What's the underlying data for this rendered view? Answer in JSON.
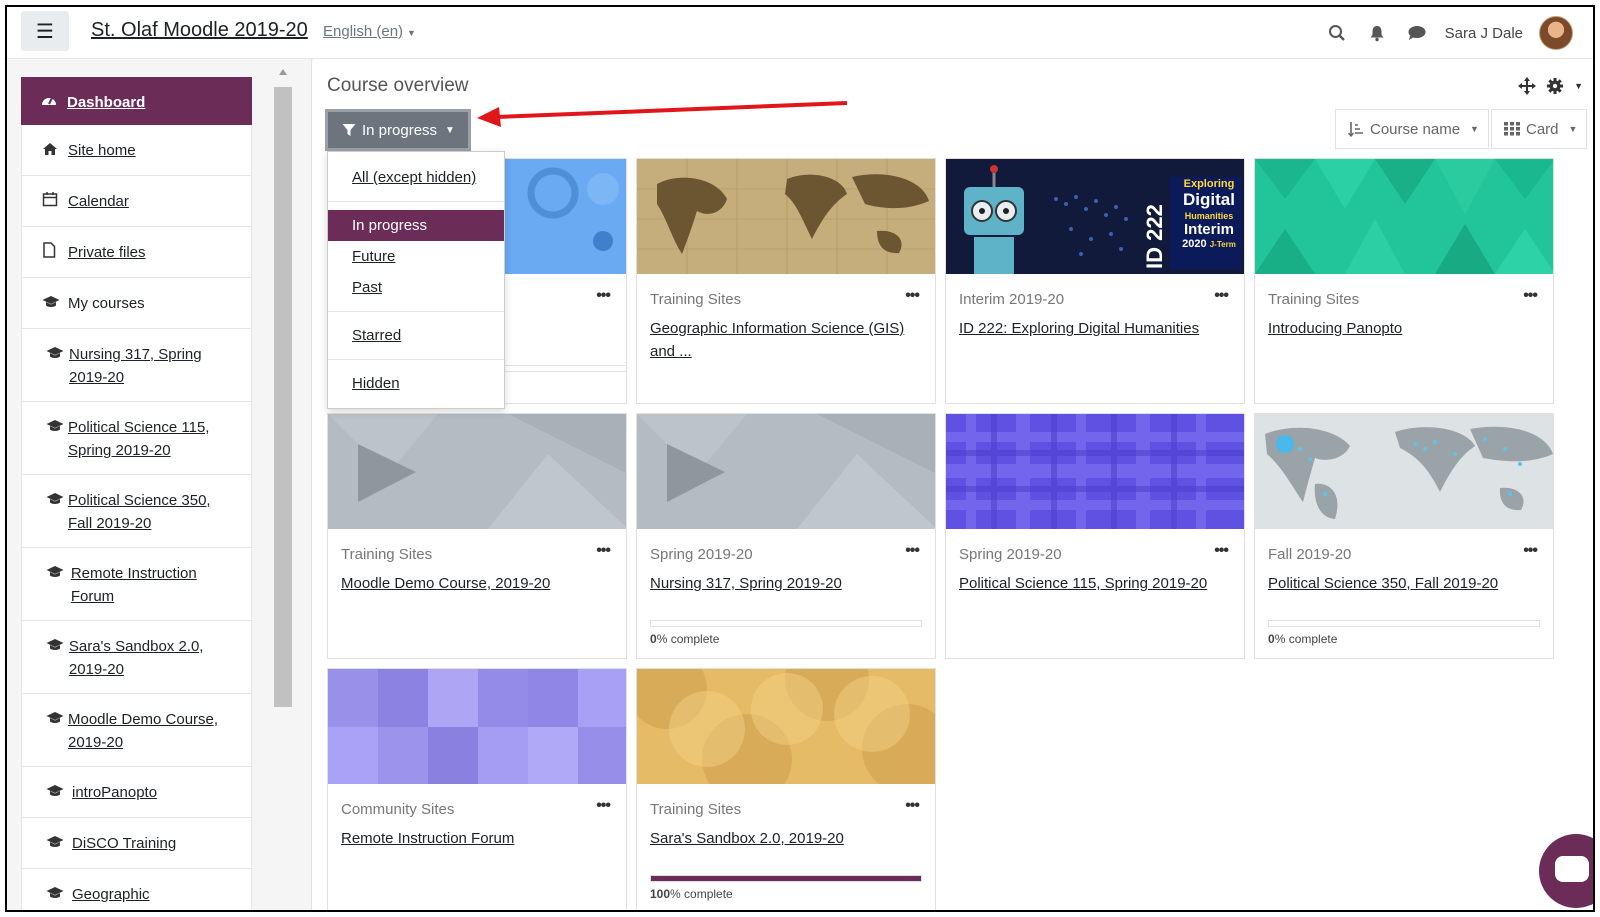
{
  "navbar": {
    "menu_icon": "hamburger-icon",
    "site_title": "St. Olaf Moodle 2019-20",
    "language": "English (en)",
    "user_name": "Sara J Dale"
  },
  "sidebar": {
    "items": [
      {
        "icon": "dashboard-icon",
        "label": "Dashboard"
      },
      {
        "icon": "home-icon",
        "label": "Site home"
      },
      {
        "icon": "calendar-icon",
        "label": "Calendar"
      },
      {
        "icon": "file-icon",
        "label": "Private files"
      },
      {
        "icon": "graduation-cap-icon",
        "label": "My courses"
      },
      {
        "icon": "graduation-cap-icon",
        "label": "Nursing 317, Spring 2019-20"
      },
      {
        "icon": "graduation-cap-icon",
        "label": "Political Science 115, Spring 2019-20"
      },
      {
        "icon": "graduation-cap-icon",
        "label": "Political Science 350, Fall 2019-20"
      },
      {
        "icon": "graduation-cap-icon",
        "label": "Remote Instruction Forum"
      },
      {
        "icon": "graduation-cap-icon",
        "label": "Sara's Sandbox 2.0, 2019-20"
      },
      {
        "icon": "graduation-cap-icon",
        "label": "Moodle Demo Course, 2019-20"
      },
      {
        "icon": "graduation-cap-icon",
        "label": "introPanopto"
      },
      {
        "icon": "graduation-cap-icon",
        "label": "DiSCO Training"
      },
      {
        "icon": "graduation-cap-icon",
        "label": "Geographic"
      }
    ]
  },
  "main": {
    "block_title": "Course overview",
    "filter_label": "In progress",
    "sort_label": "Course name",
    "view_label": "Card",
    "dropdown": [
      "All (except hidden)",
      "In progress",
      "Future",
      "Past",
      "Starred",
      "Hidden"
    ],
    "cards": [
      {
        "category": "",
        "name": "",
        "progress": null
      },
      {
        "category": "Training Sites",
        "name": "Geographic Information Science (GIS) and ...",
        "progress": null
      },
      {
        "category": "Interim 2019-20",
        "name": "ID 222: Exploring Digital Humanities",
        "progress": null
      },
      {
        "category": "Training Sites",
        "name": "Introducing Panopto",
        "progress": null
      },
      {
        "category": "Training Sites",
        "name": "Moodle Demo Course, 2019-20",
        "progress": null
      },
      {
        "category": "Spring 2019-20",
        "name": "Nursing 317, Spring 2019-20",
        "progress": 0,
        "progress_pct": "0",
        "progress_text": "% complete"
      },
      {
        "category": "Spring 2019-20",
        "name": "Political Science 115, Spring 2019-20",
        "progress": null
      },
      {
        "category": "Fall 2019-20",
        "name": "Political Science 350, Fall 2019-20",
        "progress": 0,
        "progress_pct": "0",
        "progress_text": "% complete"
      },
      {
        "category": "Community Sites",
        "name": "Remote Instruction Forum",
        "progress": null
      },
      {
        "category": "Training Sites",
        "name": "Sara's Sandbox 2.0, 2019-20",
        "progress": 100,
        "progress_pct": "100",
        "progress_text": "% complete"
      }
    ],
    "card_menu": "•••",
    "id222_image_text": [
      "ID 222",
      "Exploring",
      "Digital",
      "Humanities",
      "Interim",
      "2020",
      "J-Term"
    ]
  },
  "colors": {
    "accent": "#6b2c58",
    "filter_button": "#6c757d",
    "arrow": "#e0161b"
  }
}
